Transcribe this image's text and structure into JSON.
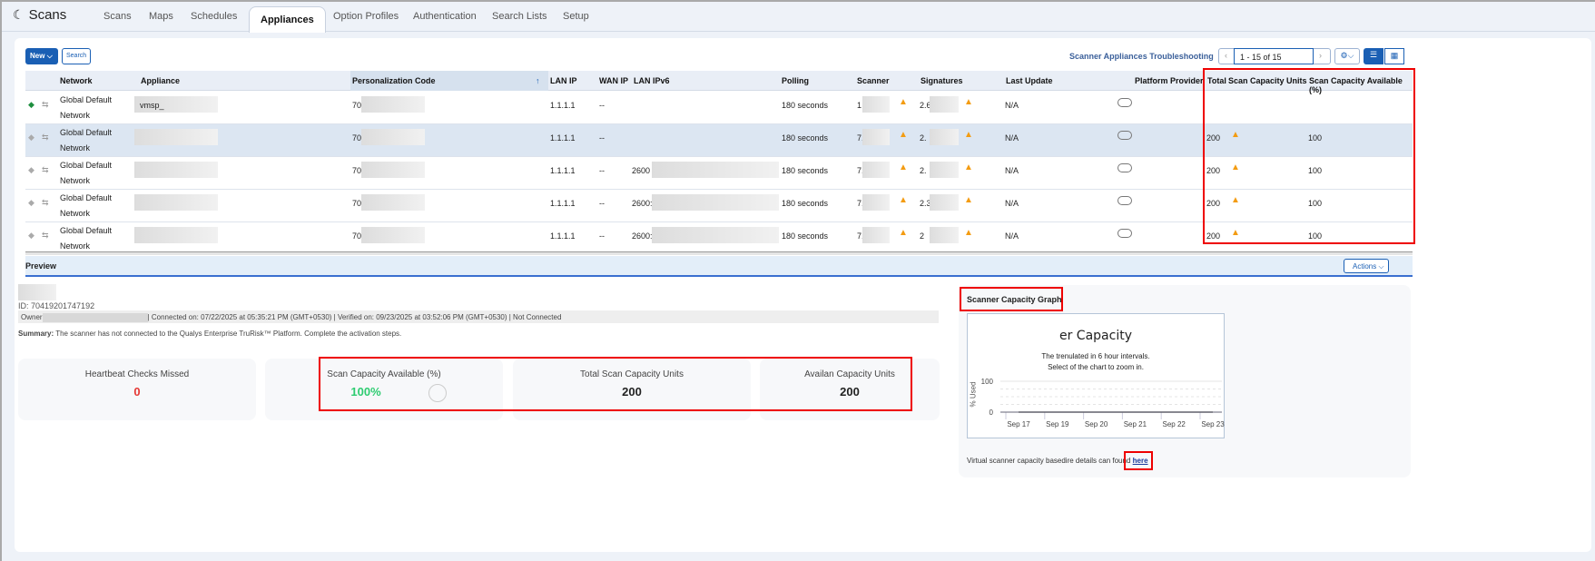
{
  "app": {
    "title": "Scans"
  },
  "tabs": [
    {
      "label": "Scans"
    },
    {
      "label": "Maps"
    },
    {
      "label": "Schedules"
    },
    {
      "label": "Appliances",
      "active": true
    },
    {
      "label": "Option Profiles"
    },
    {
      "label": "Authentication"
    },
    {
      "label": "Search Lists"
    },
    {
      "label": "Setup"
    }
  ],
  "toolbar": {
    "new_label": "New",
    "search_label": "Search",
    "troubleshooting_link": "Scanner Appliances Troubleshooting",
    "pagination": "1 - 15 of 15"
  },
  "table": {
    "columns": [
      "Network",
      "Appliance",
      "Personalization Code",
      "LAN IP",
      "WAN IP",
      "LAN IPv6",
      "Polling",
      "Scanner",
      "Signatures",
      "Last Update",
      "Platform Provider",
      "Total",
      "Scan Capacity Units",
      "Scan Capacity Available (%)"
    ],
    "rows": [
      {
        "network": "Global Default Network",
        "appliance": "vmsp_",
        "code": "704",
        "lan_ip": "1.1.1.1",
        "wan_ip": "--",
        "ipv6": "",
        "polling": "180 seconds",
        "scanner": "1·",
        "signatures": "2.6",
        "last_update": "N/A",
        "total": "",
        "available": "",
        "status": "connected"
      },
      {
        "network": "Global Default Network",
        "appliance": "",
        "code": "70",
        "lan_ip": "1.1.1.1",
        "wan_ip": "--",
        "ipv6": "",
        "polling": "180 seconds",
        "scanner": "7.1",
        "signatures": "2.",
        "last_update": "N/A",
        "total": "200",
        "available": "100",
        "status": "off"
      },
      {
        "network": "Global Default Network",
        "appliance": "",
        "code": "70",
        "lan_ip": "1.1.1.1",
        "wan_ip": "--",
        "ipv6": "2600",
        "polling": "180 seconds",
        "scanner": "7.",
        "signatures": "2.",
        "last_update": "N/A",
        "total": "200",
        "available": "100",
        "status": "off"
      },
      {
        "network": "Global Default Network",
        "appliance": "",
        "code": "70",
        "lan_ip": "1.1.1.1",
        "wan_ip": "--",
        "ipv6": "2600:",
        "polling": "180 seconds",
        "scanner": "7.",
        "signatures": "2.3",
        "last_update": "N/A",
        "total": "200",
        "available": "100",
        "status": "off"
      },
      {
        "network": "Global Default Network",
        "appliance": "",
        "code": "70",
        "lan_ip": "1.1.1.1",
        "wan_ip": "--",
        "ipv6": "2600:",
        "polling": "180 seconds",
        "scanner": "7.1",
        "signatures": "2",
        "last_update": "N/A",
        "total": "200",
        "available": "100",
        "status": "off"
      }
    ]
  },
  "preview": {
    "title": "Preview",
    "actions_label": "Actions",
    "id_line": "ID: 70419201747192",
    "owner_label": "Owner",
    "connection_line": "| Connected on: 07/22/2025 at 05:35:21 PM (GMT+0530) | Verified on: 09/23/2025 at 03:52:06 PM (GMT+0530) | Not Connected",
    "summary_label": "Summary:",
    "summary_text": "The scanner has not connected to the Qualys Enterprise TruRisk™ Platform. Complete the activation steps."
  },
  "cards": [
    {
      "label": "Heartbeat Checks Missed",
      "value": "0",
      "color": "#e53935"
    },
    {
      "label": "Scan Capacity Available (%)",
      "value": "100%",
      "color": "#2ecc71"
    },
    {
      "label": "Total Scan Capacity Units",
      "value": "200",
      "color": "#222"
    },
    {
      "label": "Availan Capacity Units",
      "value": "200",
      "color": "#222"
    }
  ],
  "graph": {
    "heading": "Scanner Capacity Graph",
    "footer_text": "Virtual scanner capacity basedire details can found",
    "footer_link": "here"
  },
  "chart_data": {
    "type": "line",
    "title": "er Capacity",
    "subtitle_1": "The trenulated in 6 hour intervals.",
    "subtitle_2": "Select of the chart to zoom in.",
    "ylabel": "% Used",
    "ylim": [
      0,
      100
    ],
    "yticks": [
      "0",
      "100"
    ],
    "categories": [
      "Sep 17",
      "Sep 19",
      "Sep 20",
      "Sep 21",
      "Sep 22",
      "Sep 23"
    ],
    "series": [
      {
        "name": "% Used",
        "values": [
          0,
          0,
          0,
          0,
          0,
          0
        ]
      }
    ]
  }
}
